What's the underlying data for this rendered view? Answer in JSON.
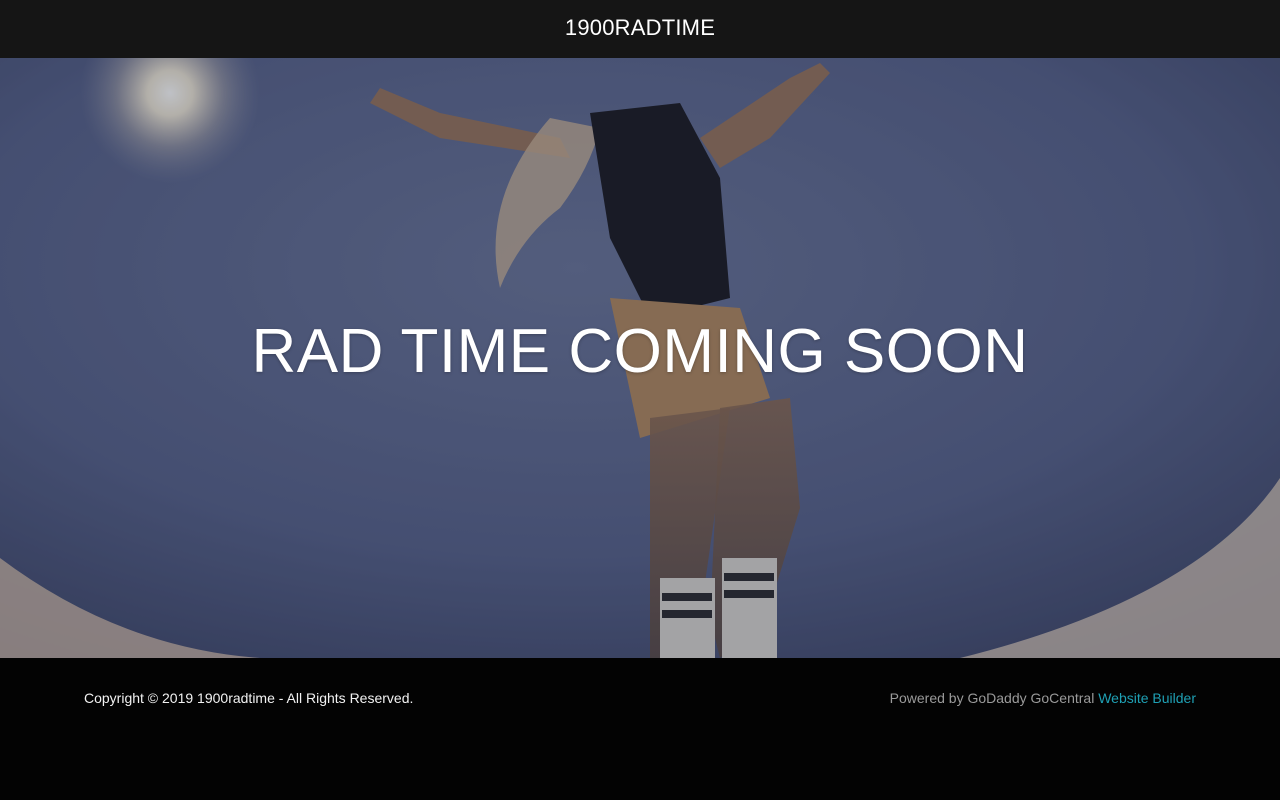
{
  "header": {
    "site_title": "1900RADTIME"
  },
  "hero": {
    "heading": "RAD TIME COMING SOON"
  },
  "footer": {
    "copyright": "Copyright © 2019 1900radtime - All Rights Reserved.",
    "powered_by_text": "Powered by GoDaddy GoCentral",
    "builder_link": "Website Builder"
  },
  "colors": {
    "header_bg": "#151515",
    "footer_bg": "#030303",
    "link": "#1fa0b4",
    "sky": "#525d84"
  }
}
